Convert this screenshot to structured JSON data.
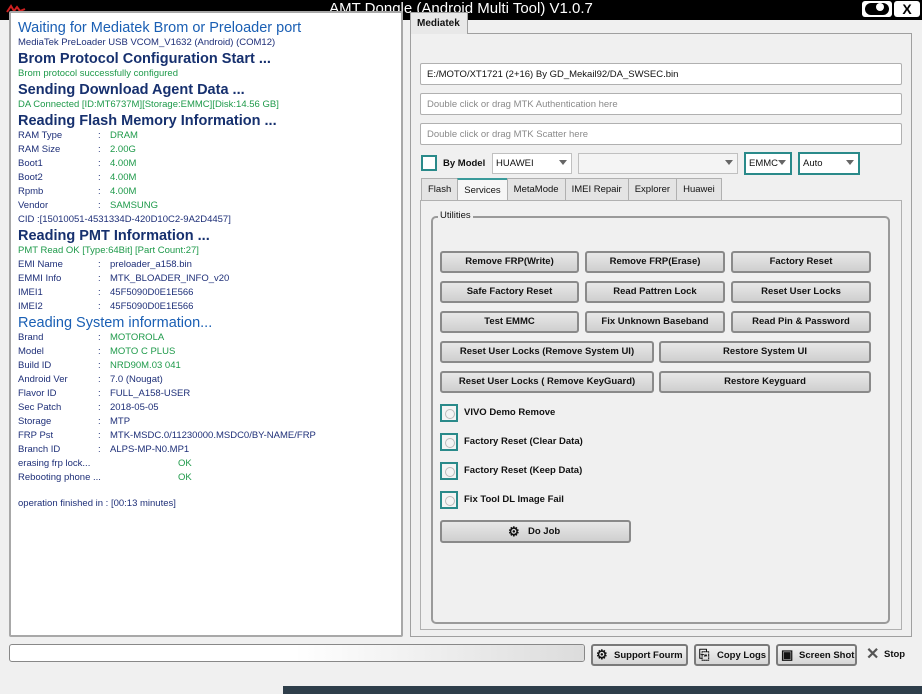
{
  "window": {
    "title": "AMT Dongle (Android Multi Tool) V1.0.7",
    "close_label": "X"
  },
  "log": {
    "waiting": "Waiting for Mediatek Brom or Preloader port",
    "port": "MediaTek PreLoader USB VCOM_V1632 (Android) (COM12)",
    "brom_start": "Brom Protocol Configuration Start ...",
    "brom_ok": "Brom protocol successfully configured",
    "da_send": "Sending Download Agent Data ...",
    "da_ok": "DA Connected [ID:MT6737M][Storage:EMMC][Disk:14.56 GB]",
    "flash_read": "Reading Flash Memory Information ...",
    "flash": [
      {
        "k": "RAM Type",
        "v": "DRAM"
      },
      {
        "k": "RAM Size",
        "v": "2.00G"
      },
      {
        "k": "Boot1",
        "v": "4.00M"
      },
      {
        "k": "Boot2",
        "v": "4.00M"
      },
      {
        "k": "Rpmb",
        "v": "4.00M"
      },
      {
        "k": "Vendor",
        "v": "SAMSUNG"
      }
    ],
    "cid": "CID :[15010051-4531334D-420D10C2-9A2D4457]",
    "pmt_read": "Reading PMT Information ...",
    "pmt_ok": "PMT Read OK [Type:64Bit] [Part Count:27]",
    "pmt": [
      {
        "k": "EMI Name",
        "v": "preloader_a158.bin"
      },
      {
        "k": "EMMI Info",
        "v": "MTK_BLOADER_INFO_v20"
      },
      {
        "k": "IMEI1",
        "v": "45F5090D0E1E566"
      },
      {
        "k": "IMEI2",
        "v": "45F5090D0E1E566"
      }
    ],
    "sys_read": "Reading System information...",
    "sys": [
      {
        "k": "Brand",
        "v": "MOTOROLA"
      },
      {
        "k": "Model",
        "v": "MOTO C PLUS"
      },
      {
        "k": "Build ID",
        "v": "NRD90M.03 041"
      },
      {
        "k": "Android Ver",
        "v": "7.0 (Nougat)"
      },
      {
        "k": "Flavor ID",
        "v": "FULL_A158-USER"
      },
      {
        "k": "Sec Patch",
        "v": "2018-05-05"
      },
      {
        "k": "Storage",
        "v": "MTP"
      },
      {
        "k": "FRP Pst",
        "v": "MTK-MSDC.0/11230000.MSDC0/BY-NAME/FRP"
      },
      {
        "k": "Branch ID",
        "v": "ALPS-MP-N0.MP1"
      }
    ],
    "steps": [
      {
        "k": "erasing frp lock...",
        "v": "OK"
      },
      {
        "k": "Rebooting phone ...",
        "v": "OK"
      }
    ],
    "footer": "operation finished in : [00:13 minutes]"
  },
  "mediatek": {
    "tab_label": "Mediatek",
    "da_path": "E:/MOTO/XT1721 (2+16) By GD_Mekail92/DA_SWSEC.bin",
    "auth_placeholder": "Double click or drag MTK Authentication here",
    "scatter_placeholder": "Double click or drag MTK Scatter here",
    "by_model_label": "By Model",
    "brand_select": "HUAWEI",
    "model_select": "",
    "storage_select": "EMMC",
    "mode_select": "Auto",
    "subtabs": [
      "Flash",
      "Services",
      "MetaMode",
      "IMEI Repair",
      "Explorer",
      "Huawei"
    ],
    "active_subtab": "Services"
  },
  "services": {
    "group_label": "Utilities",
    "buttons": {
      "remove_frp_write": "Remove FRP(Write)",
      "remove_frp_erase": "Remove FRP(Erase)",
      "factory_reset": "Factory Reset",
      "safe_factory_reset": "Safe Factory Reset",
      "read_pattern_lock": "Read Pattren Lock",
      "reset_user_locks": "Reset User Locks",
      "test_emmc": "Test EMMC",
      "fix_unknown_baseband": "Fix Unknown Baseband",
      "read_pin_password": "Read Pin & Password",
      "reset_locks_remove_system_ui": "Reset User Locks (Remove System UI)",
      "restore_system_ui": "Restore System UI",
      "reset_locks_remove_keyguard": "Reset User Locks ( Remove KeyGuard)",
      "restore_keyguard": "Restore Keyguard"
    },
    "options": [
      "VIVO Demo Remove",
      "Factory Reset (Clear Data)",
      "Factory Reset (Keep Data)",
      "Fix Tool DL Image Fail"
    ],
    "do_job": "Do Job"
  },
  "bottom": {
    "support_forum": "Support Fourm",
    "copy_logs": "Copy Logs",
    "screen_shot": "Screen Shot",
    "stop": "Stop"
  },
  "colors": {
    "accent": "#2a8a8a",
    "log_heading": "#16306e",
    "log_ok": "#1e9a4a"
  }
}
